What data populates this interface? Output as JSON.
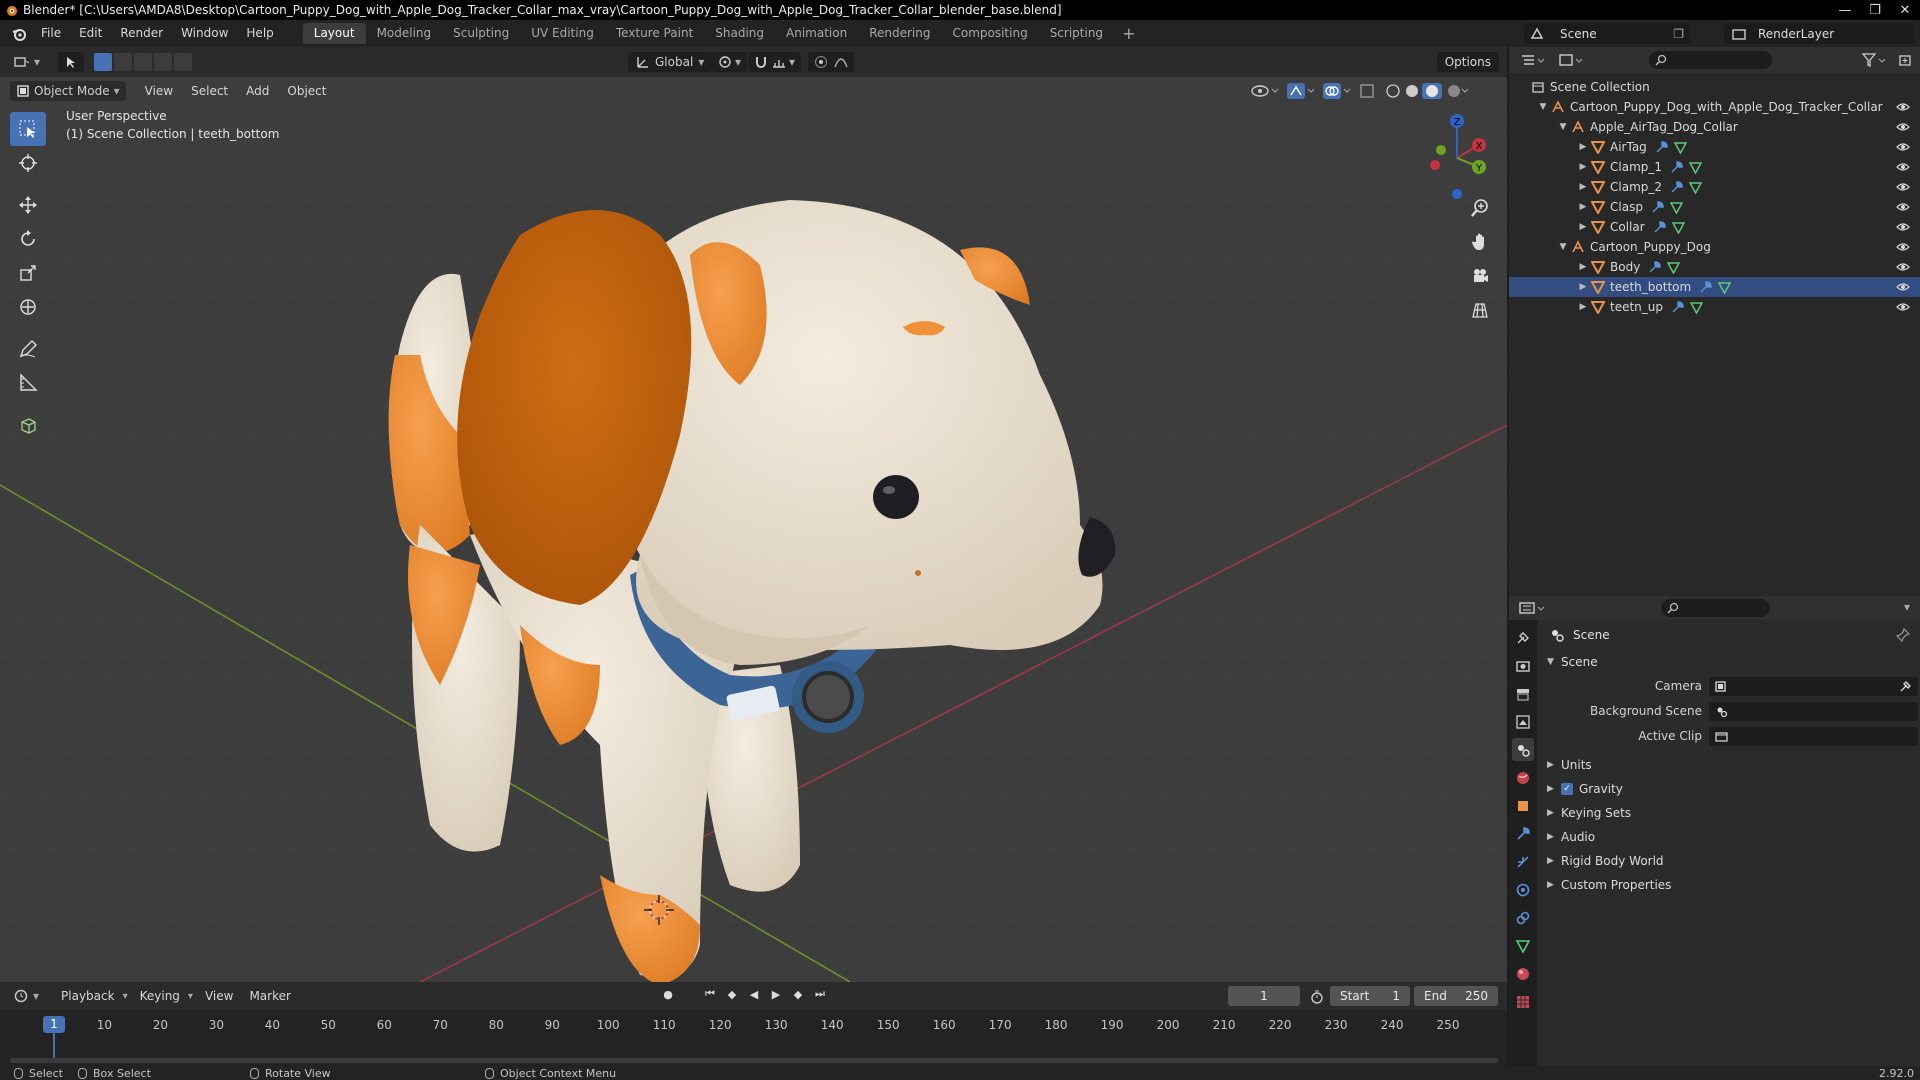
{
  "window": {
    "title": "Blender* [C:\\Users\\AMDA8\\Desktop\\Cartoon_Puppy_Dog_with_Apple_Dog_Tracker_Collar_max_vray\\Cartoon_Puppy_Dog_with_Apple_Dog_Tracker_Collar_blender_base.blend]",
    "controls": [
      "—",
      "❐",
      "✕"
    ]
  },
  "menu": {
    "items": [
      "File",
      "Edit",
      "Render",
      "Window",
      "Help"
    ],
    "workspaces": [
      "Layout",
      "Modeling",
      "Sculpting",
      "UV Editing",
      "Texture Paint",
      "Shading",
      "Animation",
      "Rendering",
      "Compositing",
      "Scripting"
    ],
    "active_workspace": "Layout",
    "scene": "Scene",
    "render_layer": "RenderLayer"
  },
  "viewport": {
    "mode": "Object Mode",
    "menus": [
      "View",
      "Select",
      "Add",
      "Object"
    ],
    "transform_orientation": "Global",
    "options_label": "Options",
    "perspective_label": "User Perspective",
    "collection_label": "(1) Scene Collection | teeth_bottom",
    "gizmo_axes": [
      "X",
      "Y",
      "Z"
    ]
  },
  "timeline": {
    "menus": [
      "Playback",
      "Keying",
      "View",
      "Marker"
    ],
    "current_frame": "1",
    "start_label": "Start",
    "start": "1",
    "end_label": "End",
    "end": "250",
    "ticks": [
      "1",
      "10",
      "20",
      "30",
      "40",
      "50",
      "60",
      "70",
      "80",
      "90",
      "100",
      "110",
      "120",
      "130",
      "140",
      "150",
      "160",
      "170",
      "180",
      "190",
      "200",
      "210",
      "220",
      "230",
      "240",
      "250"
    ]
  },
  "statusbar": {
    "select": "Select",
    "box_select": "Box Select",
    "rotate_view": "Rotate View",
    "context_menu": "Object Context Menu",
    "version": "2.92.0"
  },
  "outliner": {
    "root": "Scene Collection",
    "collection": "Cartoon_Puppy_Dog_with_Apple_Dog_Tracker_Collar",
    "collar_group": "Apple_AirTag_Dog_Collar",
    "collar_items": [
      "AirTag",
      "Clamp_1",
      "Clamp_2",
      "Clasp",
      "Collar"
    ],
    "dog_group": "Cartoon_Puppy_Dog",
    "dog_items": [
      "Body",
      "teeth_bottom",
      "teetn_up"
    ],
    "selected": "teeth_bottom"
  },
  "properties": {
    "context": "Scene",
    "panel": "Scene",
    "camera_label": "Camera",
    "background_scene_label": "Background Scene",
    "active_clip_label": "Active Clip",
    "sections": [
      "Units",
      "Gravity",
      "Keying Sets",
      "Audio",
      "Rigid Body World",
      "Custom Properties"
    ],
    "gravity_checked": true
  },
  "colors": {
    "accent": "#4772b3",
    "dog_orange": "#f0913a",
    "dog_cream": "#ece3d5",
    "collar_blue": "#3c6595",
    "viewport_bg": "#3d3d3d"
  }
}
